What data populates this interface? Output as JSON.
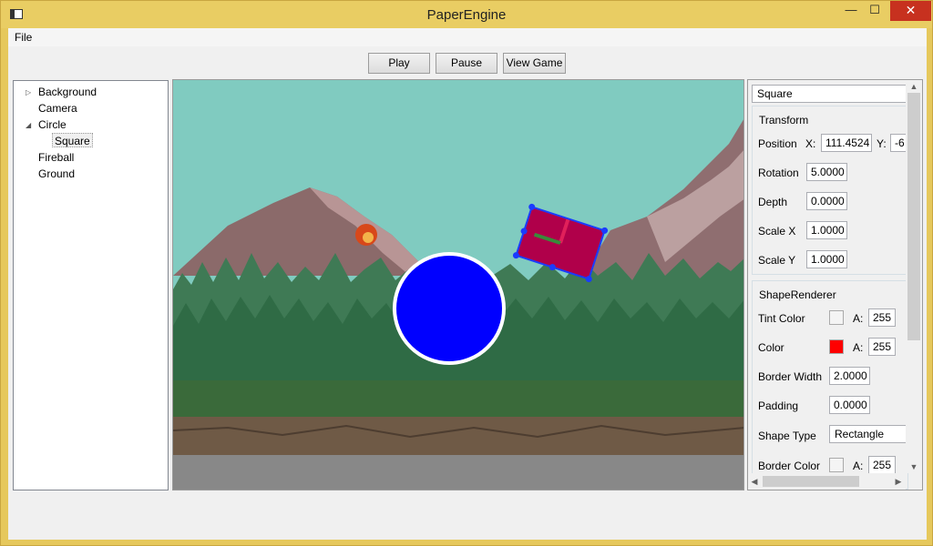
{
  "window": {
    "title": "PaperEngine",
    "controls": {
      "minimize": "—",
      "maximize": "☐",
      "close": "✕"
    }
  },
  "menu": {
    "file": "File"
  },
  "toolbar": {
    "play": "Play",
    "pause": "Pause",
    "view_game": "View Game"
  },
  "hierarchy": [
    {
      "label": "Background",
      "expander": "▷"
    },
    {
      "label": "Camera",
      "expander": ""
    },
    {
      "label": "Circle",
      "expander": "◢"
    },
    {
      "label": "Square",
      "expander": ""
    },
    {
      "label": "Fireball",
      "expander": ""
    },
    {
      "label": "Ground",
      "expander": ""
    }
  ],
  "properties": {
    "object_name": "Square",
    "transform": {
      "title": "Transform",
      "position_label": "Position",
      "x_label": "X:",
      "x_value": "111.4524",
      "y_label": "Y:",
      "y_value": "-6",
      "rotation_label": "Rotation",
      "rotation_value": "5.0000",
      "depth_label": "Depth",
      "depth_value": "0.0000",
      "scale_x_label": "Scale X",
      "scale_x_value": "1.0000",
      "scale_y_label": "Scale Y",
      "scale_y_value": "1.0000"
    },
    "shape_renderer": {
      "title": "ShapeRenderer",
      "tint_label": "Tint Color",
      "tint_color": "#f4f4f4",
      "tint_alpha_label": "A:",
      "tint_alpha": "255",
      "color_label": "Color",
      "color_value": "#ff0000",
      "color_alpha_label": "A:",
      "color_alpha": "255",
      "border_width_label": "Border Width",
      "border_width": "2.0000",
      "padding_label": "Padding",
      "padding": "0.0000",
      "shape_type_label": "Shape Type",
      "shape_type": "Rectangle",
      "border_color_label": "Border Color",
      "border_color": "#f4f4f4",
      "border_alpha_label": "A:",
      "border_alpha": "255"
    }
  },
  "scene": {
    "sky_color": "#80cbc0",
    "circle_color": "#0000ff",
    "square_color": "#b0004a",
    "selection_color": "#1a3cff",
    "ground_color": "#888888"
  }
}
